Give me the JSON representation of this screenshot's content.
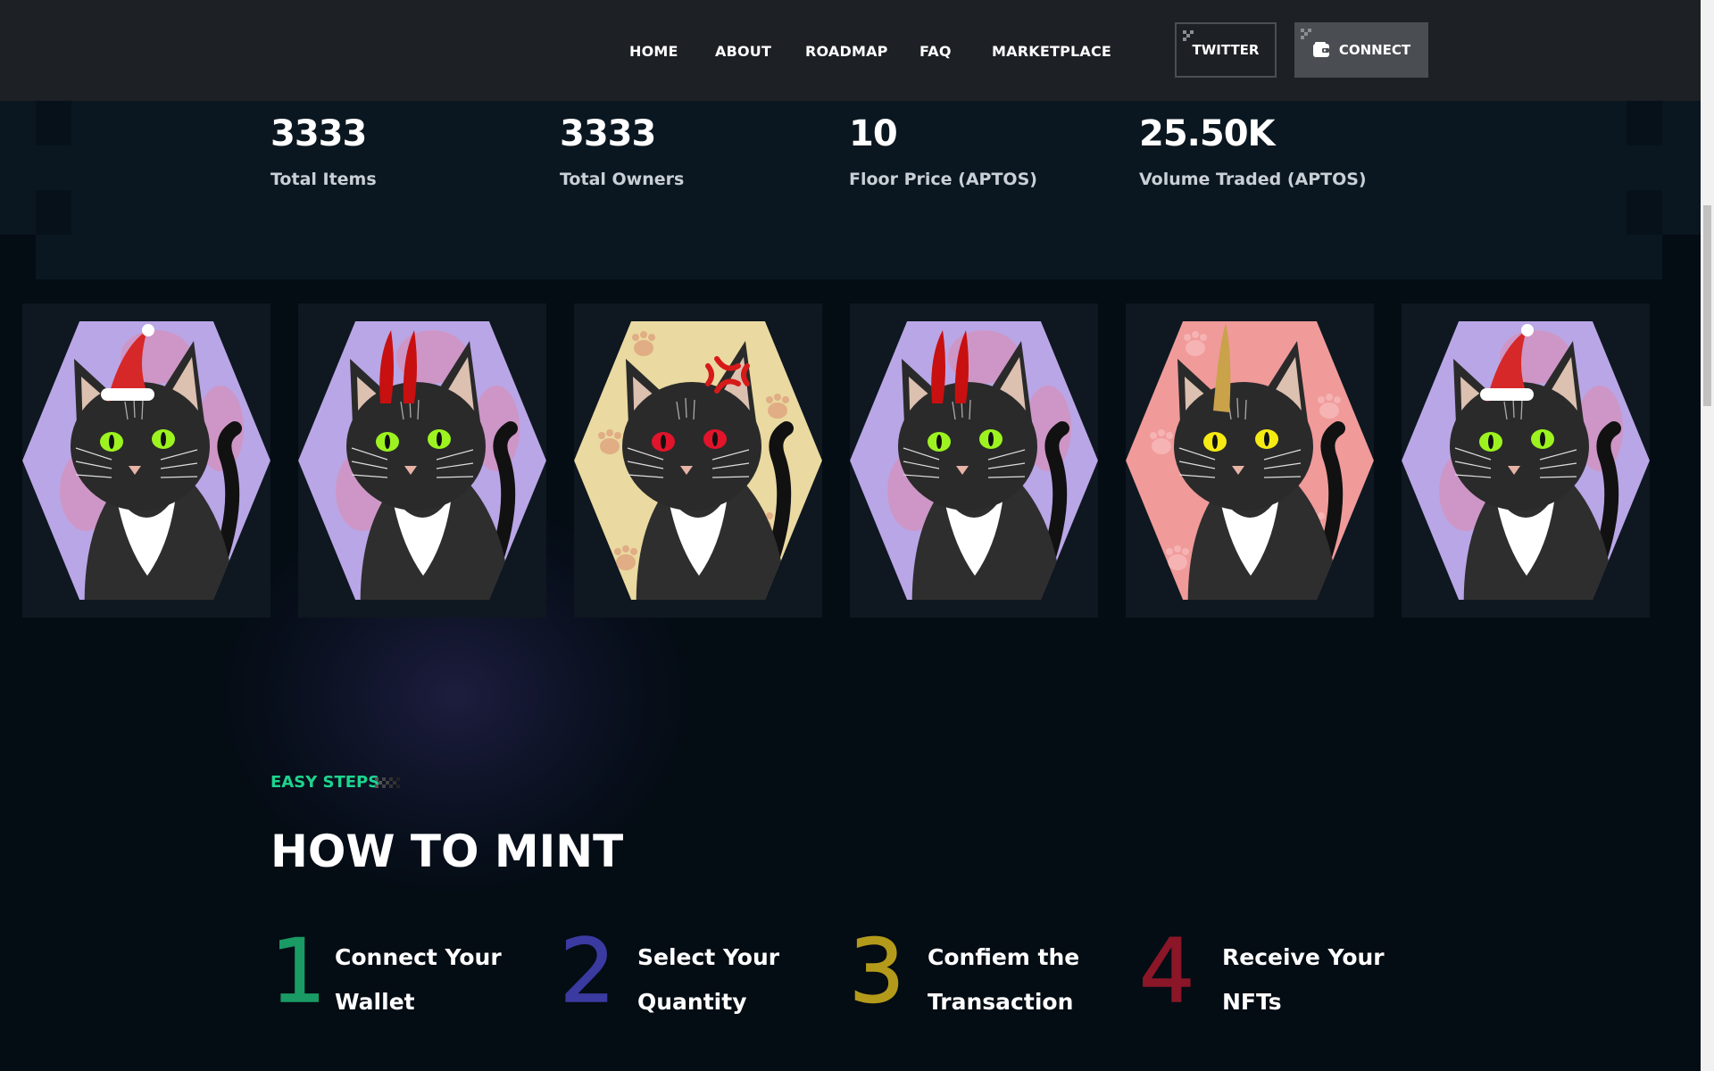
{
  "nav": {
    "links": [
      "HOME",
      "ABOUT",
      "ROADMAP",
      "FAQ",
      "MARKETPLACE"
    ],
    "twitter_label": "TWITTER",
    "connect_label": "CONNECT"
  },
  "stats": [
    {
      "value": "3333",
      "label": "Total Items"
    },
    {
      "value": "3333",
      "label": "Total Owners"
    },
    {
      "value": "10",
      "label": "Floor Price (APTOS)"
    },
    {
      "value": "25.50K",
      "label": "Volume Traded (APTOS)"
    }
  ],
  "gallery": [
    {
      "background": "#b9a6e6",
      "eyes": "#9df31f",
      "accessory": "santa-hat"
    },
    {
      "background": "#b9a6e6",
      "eyes": "#9df31f",
      "accessory": "devil-horns"
    },
    {
      "background": "#ead9a0",
      "eyes": "#e0142b",
      "accessory": "anger-mark"
    },
    {
      "background": "#b9a6e6",
      "eyes": "#9df31f",
      "accessory": "devil-horns"
    },
    {
      "background": "#f09a9a",
      "eyes": "#f6ea15",
      "accessory": "unicorn-horn"
    },
    {
      "background": "#b9a6e6",
      "eyes": "#9df31f",
      "accessory": "santa-hat"
    }
  ],
  "how_to_mint": {
    "eyebrow": "EASY STEPS",
    "title": "HOW TO MINT",
    "steps": [
      {
        "number": "1",
        "line1": "Connect Your",
        "line2": "Wallet",
        "color": "#1a9a64"
      },
      {
        "number": "2",
        "line1": "Select Your",
        "line2": "Quantity",
        "color": "#3a3aa0"
      },
      {
        "number": "3",
        "line1": "Confiem the",
        "line2": "Transaction",
        "color": "#b49a1a"
      },
      {
        "number": "4",
        "line1": "Receive Your",
        "line2": "NFTs",
        "color": "#8a1628"
      }
    ]
  },
  "colors": {
    "accent": "#1dd48e",
    "background": "#040c14",
    "header": "#1d2024"
  }
}
